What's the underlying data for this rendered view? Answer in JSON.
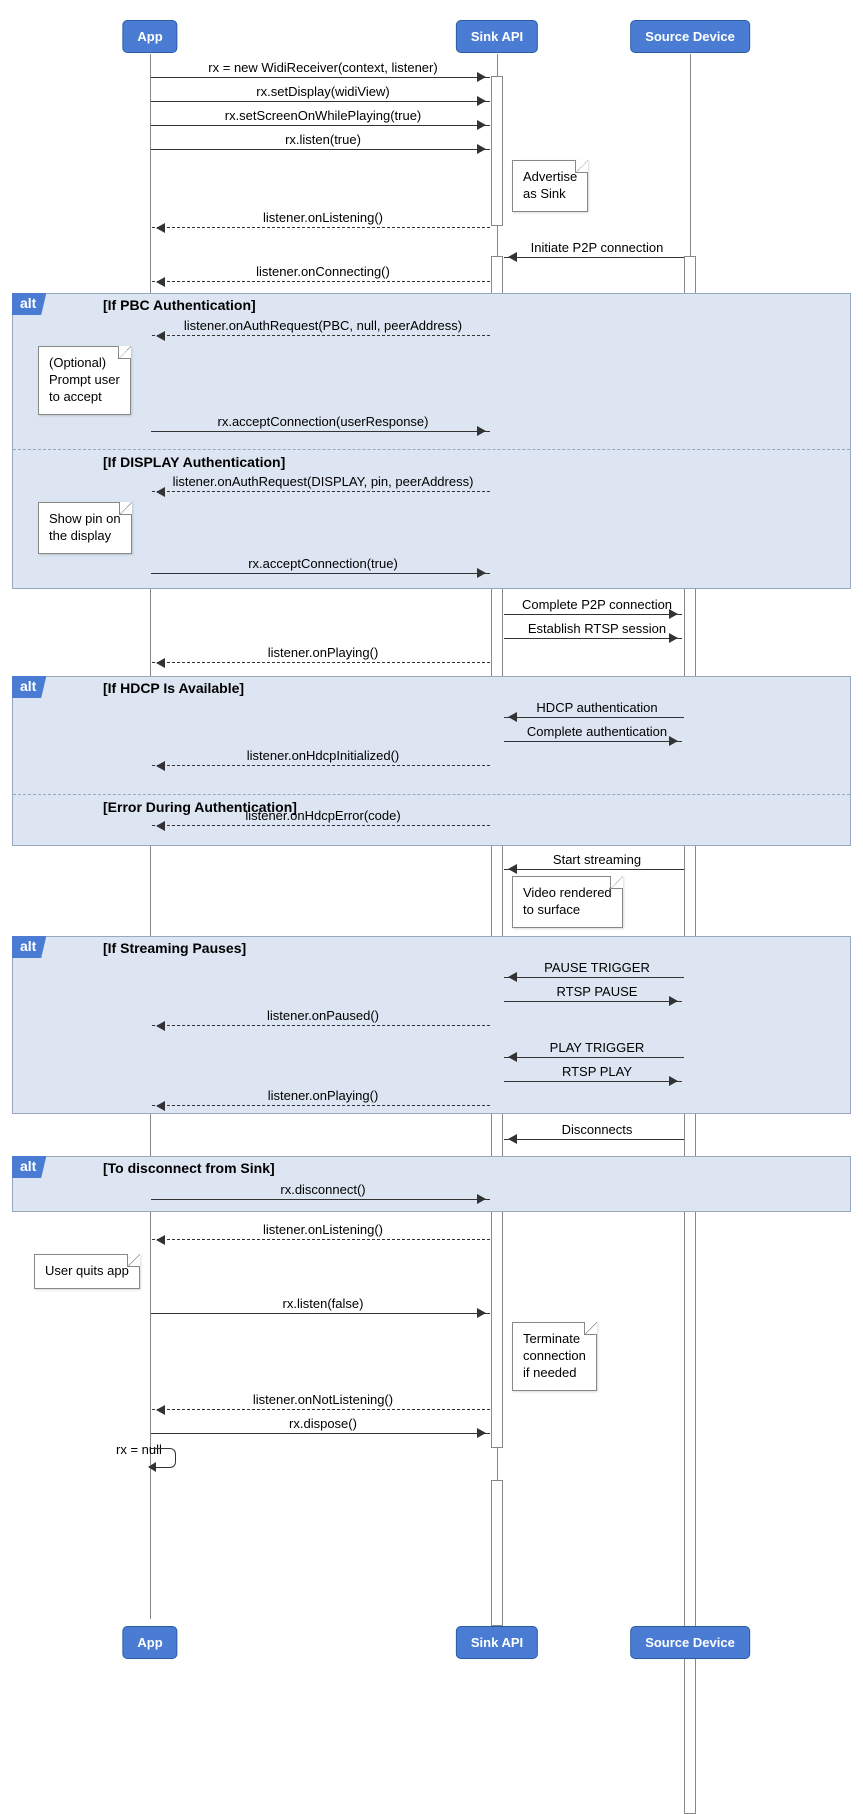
{
  "actors": {
    "app": "App",
    "sink": "Sink API",
    "source": "Source Device"
  },
  "lanes": {
    "app": 150,
    "sink": 497,
    "source": 690
  },
  "messages": {
    "m1": "rx = new WidiReceiver(context, listener)",
    "m2": "rx.setDisplay(widiView)",
    "m3": "rx.setScreenOnWhilePlaying(true)",
    "m4": "rx.listen(true)",
    "n1": "Advertise\nas Sink",
    "m5": "listener.onListening()",
    "m6": "Initiate P2P connection",
    "m7": "listener.onConnecting()",
    "alt1_title": "[If PBC Authentication]",
    "m8": "listener.onAuthRequest(PBC, null, peerAddress)",
    "n2": "(Optional)\nPrompt user\nto accept",
    "m9": "rx.acceptConnection(userResponse)",
    "alt1_sub": "[If DISPLAY Authentication]",
    "m10": "listener.onAuthRequest(DISPLAY, pin, peerAddress)",
    "n3": "Show pin on\nthe display",
    "m11": "rx.acceptConnection(true)",
    "m12": "Complete P2P connection",
    "m13": "Establish RTSP session",
    "m14": "listener.onPlaying()",
    "alt2_title": "[If HDCP Is Available]",
    "m15": "HDCP authentication",
    "m16": "Complete authentication",
    "m17": "listener.onHdcpInitialized()",
    "alt2_sub": "[Error During Authentication]",
    "m18": "listener.onHdcpError(code)",
    "m19": "Start streaming",
    "n4": "Video rendered\nto surface",
    "alt3_title": "[If Streaming Pauses]",
    "m20": "PAUSE TRIGGER",
    "m21": "RTSP PAUSE",
    "m22": "listener.onPaused()",
    "m23": "PLAY TRIGGER",
    "m24": "RTSP PLAY",
    "m25": "listener.onPlaying()",
    "m26": "Disconnects",
    "alt4_title": "[To disconnect from Sink]",
    "m27": "rx.disconnect()",
    "m28": "listener.onListening()",
    "n5": "User quits app",
    "m29": "rx.listen(false)",
    "n6": "Terminate\nconnection\nif needed",
    "m30": "listener.onNotListening()",
    "m31": "rx.dispose()",
    "m32": "rx = null",
    "alt_tag": "alt"
  }
}
